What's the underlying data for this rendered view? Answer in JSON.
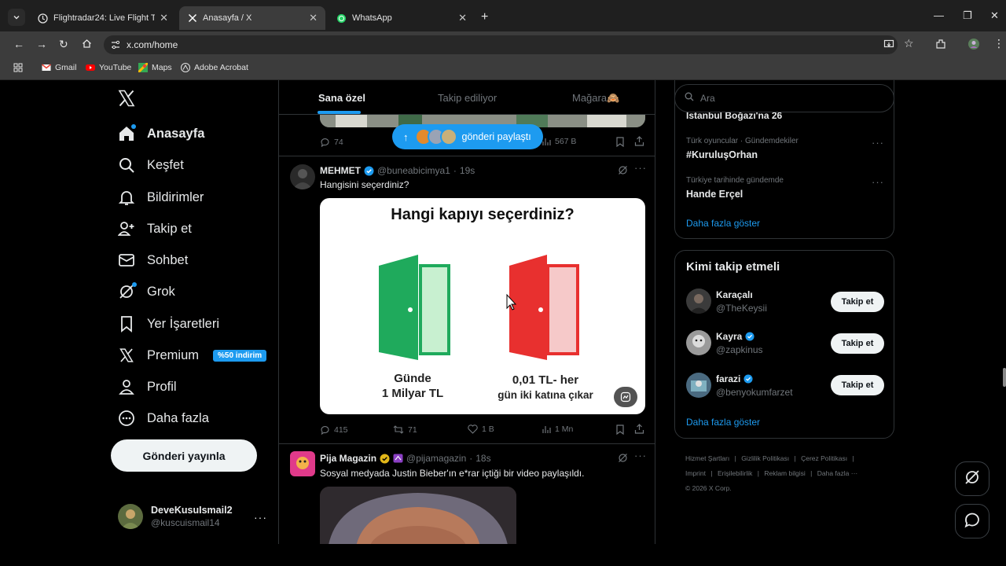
{
  "browser": {
    "tabs": [
      {
        "title": "Flightradar24: Live Flight Tracker",
        "icon": "flightradar-icon",
        "active": false
      },
      {
        "title": "Anasayfa / X",
        "icon": "x-logo-icon",
        "active": true
      },
      {
        "title": "WhatsApp",
        "icon": "whatsapp-icon",
        "active": false
      }
    ],
    "url": "x.com/home",
    "bookmarks": [
      {
        "label": "Gmail",
        "icon": "gmail-icon"
      },
      {
        "label": "YouTube",
        "icon": "youtube-icon"
      },
      {
        "label": "Maps",
        "icon": "maps-icon"
      },
      {
        "label": "Adobe Acrobat",
        "icon": "acrobat-icon"
      }
    ]
  },
  "sidebar": {
    "items": [
      {
        "label": "Anasayfa",
        "icon": "home-icon"
      },
      {
        "label": "Keşfet",
        "icon": "search-icon"
      },
      {
        "label": "Bildirimler",
        "icon": "bell-icon"
      },
      {
        "label": "Takip et",
        "icon": "add-user-icon"
      },
      {
        "label": "Sohbet",
        "icon": "mail-icon"
      },
      {
        "label": "Grok",
        "icon": "grok-icon"
      },
      {
        "label": "Yer İşaretleri",
        "icon": "bookmark-icon"
      },
      {
        "label": "Premium",
        "icon": "x-logo-icon",
        "badge": "%50 indirim"
      },
      {
        "label": "Profil",
        "icon": "profile-icon"
      },
      {
        "label": "Daha fazla",
        "icon": "more-circle-icon"
      }
    ],
    "post_button": "Gönderi yayınla",
    "account": {
      "name": "DeveKusuIsmail2",
      "handle": "@kuscuismail14"
    }
  },
  "feed": {
    "tabs": [
      "Sana özel",
      "Takip ediliyor",
      "Mağara🙈"
    ],
    "prev_tweet_stats": {
      "replies": "74",
      "views": "567 B"
    },
    "new_posts_pill": "gönderi paylaştı",
    "tweet1": {
      "name": "MEHMET",
      "handle": "@buneabicimya1",
      "time": "19s",
      "text": "Hangisini seçerdiniz?",
      "card": {
        "title": "Hangi kapıyı seçerdiniz?",
        "left_caption_1": "Günde",
        "left_caption_2": "1 Milyar TL",
        "right_caption_1": "0,01 TL- her",
        "right_caption_2": "gün iki katına çıkar",
        "left_door_color": "#1faa5c",
        "right_door_color": "#e8302f"
      },
      "stats": {
        "replies": "415",
        "reposts": "71",
        "likes": "1 B",
        "views": "1 Mn"
      }
    },
    "tweet2": {
      "name": "Pija Magazin",
      "handle": "@pijamagazin",
      "time": "18s",
      "text": "Sosyal medyada Justin Bieber'ın e*rar içtiği bir video paylaşıldı."
    },
    "separator": "·"
  },
  "right": {
    "search_placeholder": "Ara",
    "trend_cut": "İstanbul Boğazı'na 26",
    "trends": [
      {
        "context": "Türk oyuncular · Gündemdekiler",
        "name": "#KuruluşOrhan"
      },
      {
        "context": "Türkiye tarihinde gündemde",
        "name": "Hande Erçel"
      }
    ],
    "show_more": "Daha fazla göster",
    "who_to_follow": {
      "title": "Kimi takip etmeli",
      "users": [
        {
          "name": "Karaçalı",
          "handle": "@TheKeysii",
          "verified": false
        },
        {
          "name": "Kayra",
          "handle": "@zapkinus",
          "verified": true
        },
        {
          "name": "farazi",
          "handle": "@benyokumfarzet",
          "verified": true
        }
      ],
      "follow_label": "Takip et",
      "show_more": "Daha fazla göster"
    },
    "footer": {
      "links": [
        "Hizmet Şartları",
        "|",
        "Gizlilik Politikası",
        "|",
        "Çerez Politikası",
        "|",
        "Imprint",
        "|",
        "Erişilebilirlik",
        "|",
        "Reklam bilgisi",
        "|",
        "Daha fazla ···"
      ],
      "copyright": "© 2026 X Corp."
    }
  },
  "colors": {
    "accent": "#1d9bf0",
    "background": "#000000",
    "border": "#2f3336",
    "muted": "#71767b"
  }
}
